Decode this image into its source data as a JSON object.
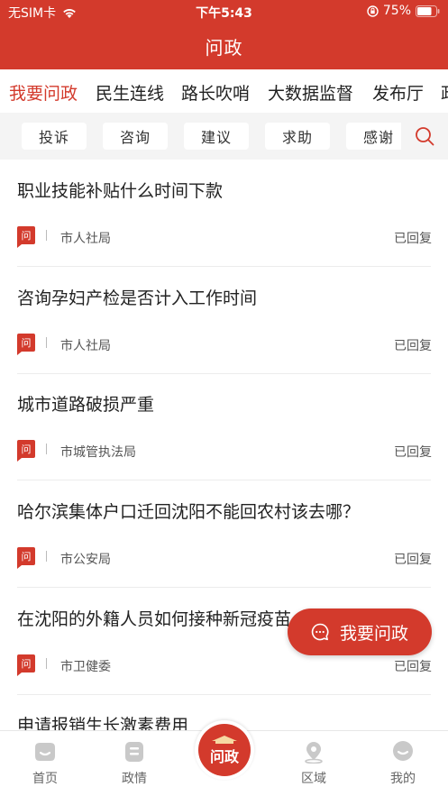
{
  "status_bar": {
    "carrier": "无SIM卡",
    "time": "下午5:43",
    "battery": "75%"
  },
  "app_title": "问政",
  "category_tabs": [
    {
      "label": "我要问政"
    },
    {
      "label": "民生连线"
    },
    {
      "label": "路长吹哨"
    },
    {
      "label": "大数据监督"
    },
    {
      "label": "发布厅"
    },
    {
      "label": "政"
    }
  ],
  "sub_tabs": [
    {
      "label": "投诉"
    },
    {
      "label": "咨询"
    },
    {
      "label": "建议"
    },
    {
      "label": "求助"
    },
    {
      "label": "感谢"
    }
  ],
  "badge_label": "问",
  "questions": [
    {
      "title": "职业技能补贴什么时间下款",
      "department": "市人社局",
      "status": "已回复"
    },
    {
      "title": "咨询孕妇产检是否计入工作时间",
      "department": "市人社局",
      "status": "已回复"
    },
    {
      "title": "城市道路破损严重",
      "department": "市城管执法局",
      "status": "已回复"
    },
    {
      "title": "哈尔滨集体户口迁回沈阳不能回农村该去哪？",
      "department": "市公安局",
      "status": "已回复"
    },
    {
      "title": "在沈阳的外籍人员如何接种新冠疫苗",
      "department": "市卫健委",
      "status": "已回复"
    },
    {
      "title": "申请报销生长激素费用",
      "department": "",
      "status": ""
    }
  ],
  "fab": {
    "label": "我要问政"
  },
  "bottom_tabs": {
    "home": "首页",
    "affairs": "政情",
    "center": "问政",
    "region": "区域",
    "mine": "我的"
  },
  "colors": {
    "brand": "#d33a2c",
    "sub_bar_bg": "#f4f4f4"
  }
}
